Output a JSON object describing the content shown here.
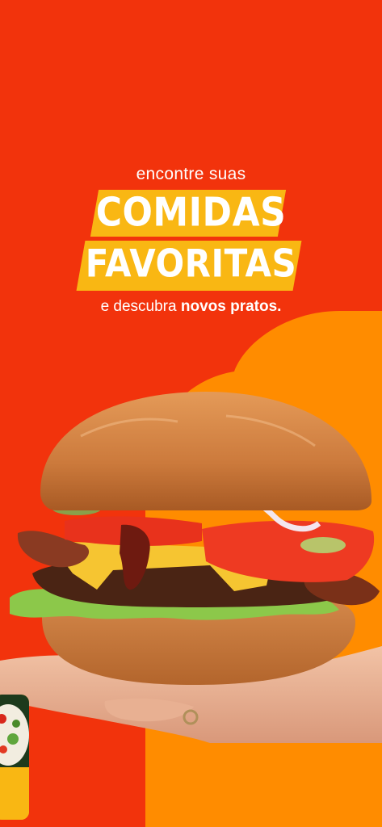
{
  "promo": {
    "intro": "encontre suas",
    "headline_line1": "COMIDAS",
    "headline_line2": "FAVORITAS",
    "tagline_prefix": "e descubra ",
    "tagline_bold": "novos pratos."
  },
  "colors": {
    "background": "#f2330c",
    "accent_blob": "#ff8c00",
    "highlight_band": "#f9b713",
    "text": "#ffffff"
  },
  "illustration": {
    "main": "burger-in-hand-image",
    "side": "salad-dish-card"
  }
}
